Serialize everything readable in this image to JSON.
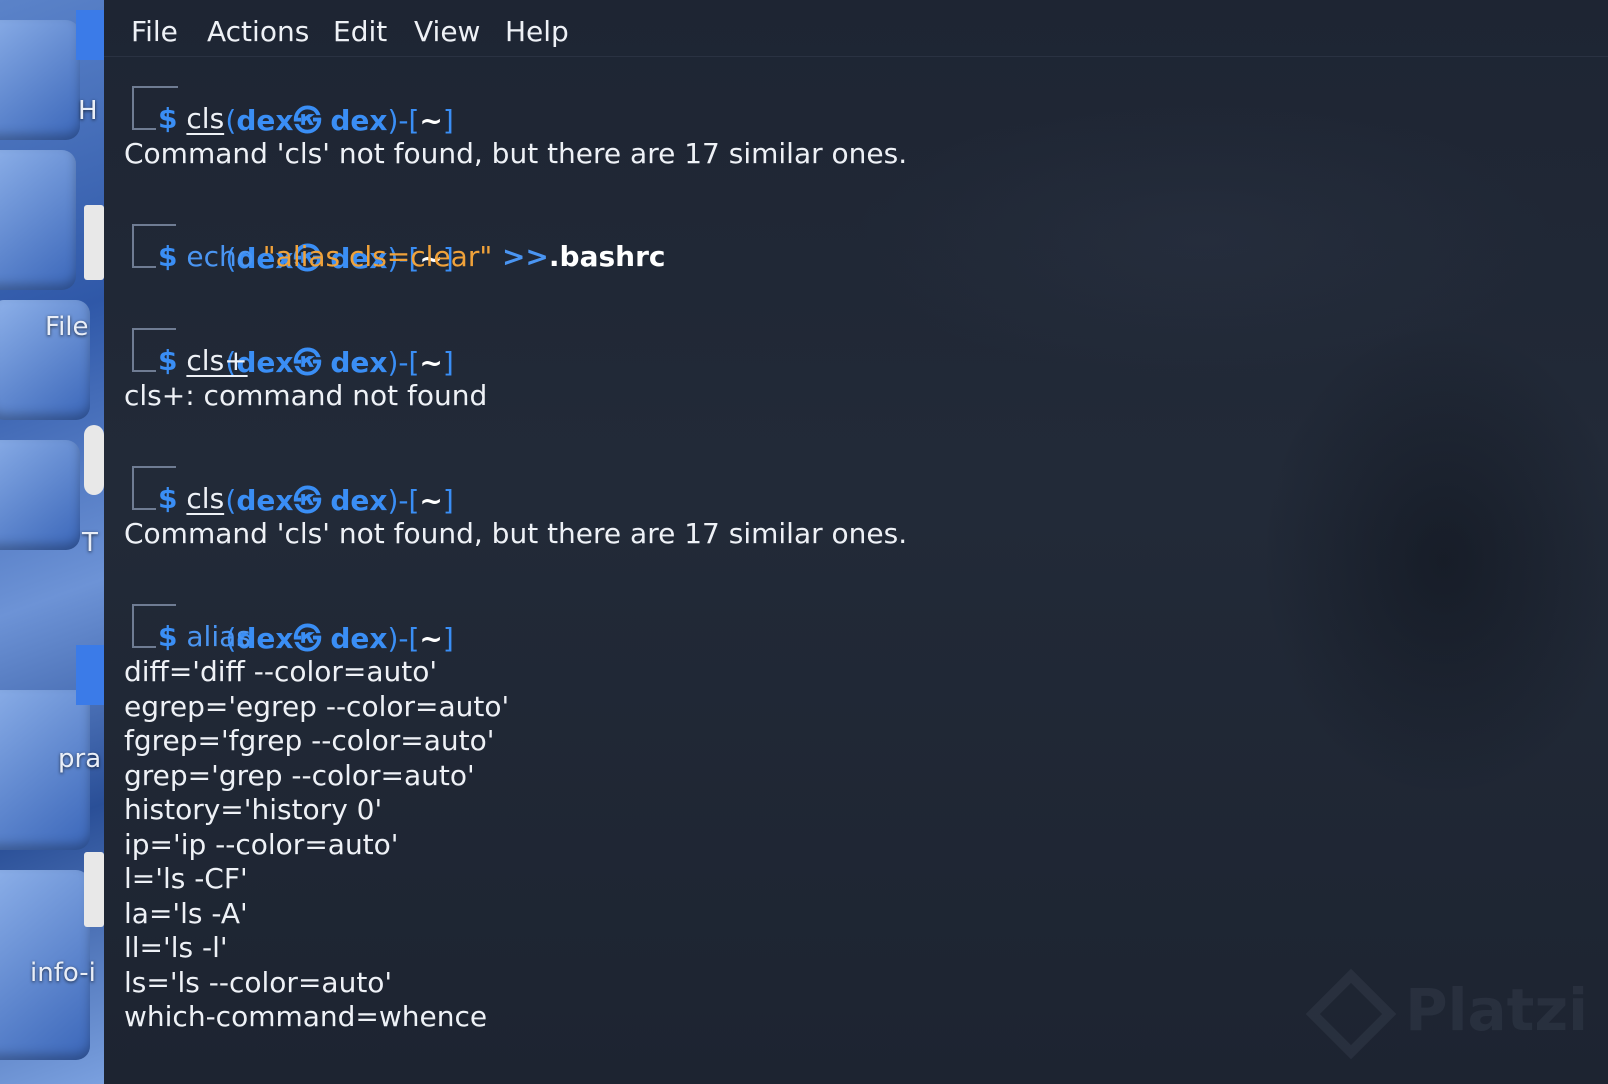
{
  "desktop": {
    "labels": [
      "H",
      "File",
      "T",
      "pra",
      "info-i"
    ]
  },
  "menu": {
    "file": "File",
    "actions": "Actions",
    "edit": "Edit",
    "view": "View",
    "help": "Help"
  },
  "prompt": {
    "open": "(",
    "user": "dex",
    "at": "㉿",
    "host": "dex",
    "close": ")",
    "dir_prefix": "-[",
    "dir": "~",
    "dir_suffix": "]",
    "dollar": "$"
  },
  "session": {
    "block1": {
      "command": "cls",
      "output": "Command 'cls' not found, but there are 17 similar ones."
    },
    "block2": {
      "cmd": "echo ",
      "arg": "\"alias cls=clear\"",
      "redirect": " >>",
      "file": ".bashrc"
    },
    "block3": {
      "command": "cls+",
      "output": "cls+: command not found"
    },
    "block4": {
      "command": "cls",
      "output": "Command 'cls' not found, but there are 17 similar ones."
    },
    "block5": {
      "command": "alias",
      "output": [
        "diff='diff --color=auto'",
        "egrep='egrep --color=auto'",
        "fgrep='fgrep --color=auto'",
        "grep='grep --color=auto'",
        "history='history 0'",
        "ip='ip --color=auto'",
        "l='ls -CF'",
        "la='ls -A'",
        "ll='ls -l'",
        "ls='ls --color=auto'",
        "which-command=whence"
      ]
    }
  },
  "watermark": "Platzi",
  "colors": {
    "prompt_blue": "#3a8ef5",
    "string_orange": "#f0a23a",
    "text": "#eef1f6",
    "background": "#1e2533"
  }
}
